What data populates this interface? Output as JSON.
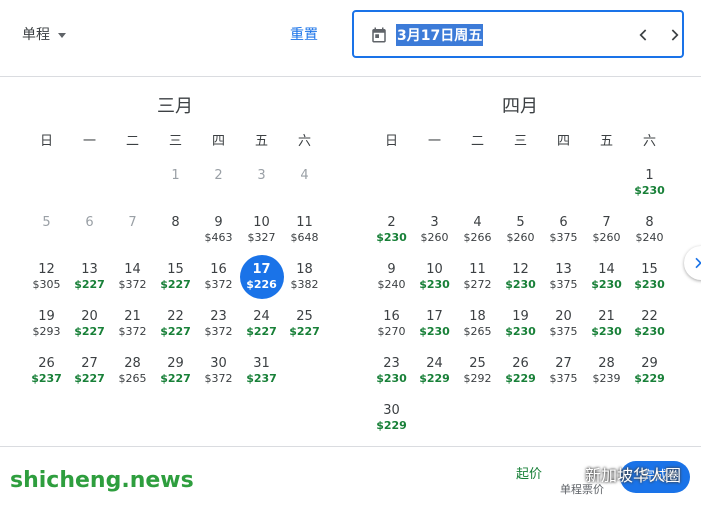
{
  "header": {
    "trip_type": "单程",
    "reset": "重置",
    "selected_date": "3月17日周五"
  },
  "weekdays": [
    "日",
    "一",
    "二",
    "三",
    "四",
    "五",
    "六"
  ],
  "months": [
    {
      "title": "三月",
      "offset": 3,
      "days": [
        {
          "d": "1",
          "p": "",
          "past": true
        },
        {
          "d": "2",
          "p": "",
          "past": true
        },
        {
          "d": "3",
          "p": "",
          "past": true
        },
        {
          "d": "4",
          "p": "",
          "past": true
        },
        {
          "d": "5",
          "p": "",
          "past": true
        },
        {
          "d": "6",
          "p": "",
          "past": true
        },
        {
          "d": "7",
          "p": "",
          "past": true
        },
        {
          "d": "8",
          "p": ""
        },
        {
          "d": "9",
          "p": "$463"
        },
        {
          "d": "10",
          "p": "$327"
        },
        {
          "d": "11",
          "p": "$648"
        },
        {
          "d": "12",
          "p": "$305"
        },
        {
          "d": "13",
          "p": "$227",
          "low": true
        },
        {
          "d": "14",
          "p": "$372"
        },
        {
          "d": "15",
          "p": "$227",
          "low": true
        },
        {
          "d": "16",
          "p": "$372"
        },
        {
          "d": "17",
          "p": "$226",
          "sel": true
        },
        {
          "d": "18",
          "p": "$382"
        },
        {
          "d": "19",
          "p": "$293"
        },
        {
          "d": "20",
          "p": "$227",
          "low": true
        },
        {
          "d": "21",
          "p": "$372"
        },
        {
          "d": "22",
          "p": "$227",
          "low": true
        },
        {
          "d": "23",
          "p": "$372"
        },
        {
          "d": "24",
          "p": "$227",
          "low": true
        },
        {
          "d": "25",
          "p": "$227",
          "low": true
        },
        {
          "d": "26",
          "p": "$237",
          "low": true
        },
        {
          "d": "27",
          "p": "$227",
          "low": true
        },
        {
          "d": "28",
          "p": "$265"
        },
        {
          "d": "29",
          "p": "$227",
          "low": true
        },
        {
          "d": "30",
          "p": "$372"
        },
        {
          "d": "31",
          "p": "$237",
          "low": true
        }
      ]
    },
    {
      "title": "四月",
      "offset": 6,
      "days": [
        {
          "d": "1",
          "p": "$230",
          "low": true
        },
        {
          "d": "2",
          "p": "$230",
          "low": true
        },
        {
          "d": "3",
          "p": "$260"
        },
        {
          "d": "4",
          "p": "$266"
        },
        {
          "d": "5",
          "p": "$260"
        },
        {
          "d": "6",
          "p": "$375"
        },
        {
          "d": "7",
          "p": "$260"
        },
        {
          "d": "8",
          "p": "$240"
        },
        {
          "d": "9",
          "p": "$240"
        },
        {
          "d": "10",
          "p": "$230",
          "low": true
        },
        {
          "d": "11",
          "p": "$272"
        },
        {
          "d": "12",
          "p": "$230",
          "low": true
        },
        {
          "d": "13",
          "p": "$375"
        },
        {
          "d": "14",
          "p": "$230",
          "low": true
        },
        {
          "d": "15",
          "p": "$230",
          "low": true
        },
        {
          "d": "16",
          "p": "$270"
        },
        {
          "d": "17",
          "p": "$230",
          "low": true
        },
        {
          "d": "18",
          "p": "$265"
        },
        {
          "d": "19",
          "p": "$230",
          "low": true
        },
        {
          "d": "20",
          "p": "$375"
        },
        {
          "d": "21",
          "p": "$230",
          "low": true
        },
        {
          "d": "22",
          "p": "$230",
          "low": true
        },
        {
          "d": "23",
          "p": "$230",
          "low": true
        },
        {
          "d": "24",
          "p": "$229",
          "low": true
        },
        {
          "d": "25",
          "p": "$292"
        },
        {
          "d": "26",
          "p": "$229",
          "low": true
        },
        {
          "d": "27",
          "p": "$375"
        },
        {
          "d": "28",
          "p": "$239"
        },
        {
          "d": "29",
          "p": "$229",
          "low": true
        },
        {
          "d": "30",
          "p": "$229",
          "low": true
        }
      ]
    }
  ],
  "footer": {
    "from_price": "起价",
    "trip_label": "单程票价",
    "done": "完成"
  },
  "watermarks": {
    "left": "shicheng.news",
    "right": "新加坡华人圈"
  },
  "colors": {
    "accent": "#1a73e8",
    "low_price": "#188038"
  },
  "icons": [
    "calendar-icon",
    "chevron-left-icon",
    "chevron-right-icon",
    "caret-down-icon"
  ]
}
